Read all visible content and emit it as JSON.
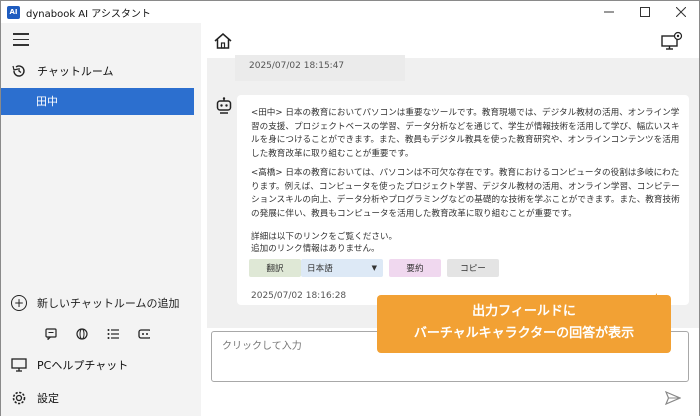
{
  "window": {
    "title": "dynabook AI アシスタント",
    "app_icon": "AI"
  },
  "sidebar": {
    "chatroom_label": "チャットルーム",
    "selected_room": "田中",
    "add_room_label": "新しいチャットルームの追加",
    "pc_help_label": "PCヘルプチャット",
    "settings_label": "設定"
  },
  "chat": {
    "prev_timestamp": "2025/07/02 18:15:47",
    "para1": "<田中> 日本の教育においてパソコンは重要なツールです。教育現場では、デジタル教材の活用、オンライン学習の支援、プロジェクトベースの学習、データ分析などを通じて、学生が情報技術を活用して学び、幅広いスキルを身につけることができます。また、教員もデジタル教具を使った教育研究や、オンラインコンテンツを活用した教育改革に取り組むことが重要です。",
    "para2": "<高橋> 日本の教育においては、パソコンは不可欠な存在です。教育におけるコンピュータの役割は多岐にわたります。例えば、コンピュータを使ったプロジェクト学習、デジタル教材の活用、オンライン学習、コンピテーションスキルの向上、データ分析やプログラミングなどの基礎的な技術を学ぶことができます。また、教育技術の発展に伴い、教員もコンピュータを活用した教育改革に取り組むことが重要です。",
    "para3_line1": "詳細は以下のリンクをご覧ください。",
    "para3_line2": "追加のリンク情報はありません。",
    "translate_label": "翻訳",
    "language_value": "日本語",
    "summary_label": "要約",
    "copy_label": "コピー",
    "timestamp": "2025/07/02 18:16:28"
  },
  "callout": {
    "line1": "出力フィールドに",
    "line2": "バーチャルキャラクターの回答が表示"
  },
  "input": {
    "placeholder": "クリックして入力"
  },
  "colors": {
    "accent": "#2c6fcf",
    "callout": "#f2a134"
  }
}
